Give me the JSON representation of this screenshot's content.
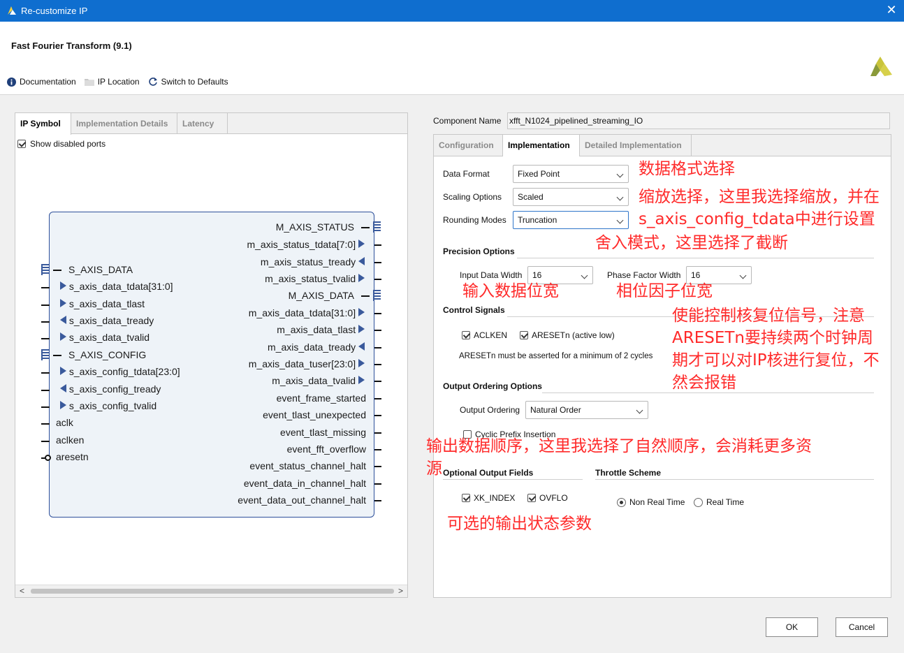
{
  "window": {
    "title": "Re-customize IP",
    "close": "✕"
  },
  "header": {
    "title": "Fast Fourier Transform (9.1)"
  },
  "toolbar": {
    "documentation": "Documentation",
    "ip_location": "IP Location",
    "switch_defaults": "Switch to Defaults"
  },
  "left_tabs": [
    "IP Symbol",
    "Implementation Details",
    "Latency"
  ],
  "show_disabled_ports": "Show disabled ports",
  "symbol": {
    "left": [
      "S_AXIS_DATA",
      "s_axis_data_tdata[31:0]",
      "s_axis_data_tlast",
      "s_axis_data_tready",
      "s_axis_data_tvalid",
      "S_AXIS_CONFIG",
      "s_axis_config_tdata[23:0]",
      "s_axis_config_tready",
      "s_axis_config_tvalid",
      "aclk",
      "aclken",
      "aresetn"
    ],
    "right": [
      "M_AXIS_STATUS",
      "m_axis_status_tdata[7:0]",
      "m_axis_status_tready",
      "m_axis_status_tvalid",
      "M_AXIS_DATA",
      "m_axis_data_tdata[31:0]",
      "m_axis_data_tlast",
      "m_axis_data_tready",
      "m_axis_data_tuser[23:0]",
      "m_axis_data_tvalid",
      "event_frame_started",
      "event_tlast_unexpected",
      "event_tlast_missing",
      "event_fft_overflow",
      "event_status_channel_halt",
      "event_data_in_channel_halt",
      "event_data_out_channel_halt"
    ]
  },
  "component": {
    "label": "Component Name",
    "value": "xfft_N1024_pipelined_streaming_IO"
  },
  "right_tabs": [
    "Configuration",
    "Implementation",
    "Detailed Implementation"
  ],
  "impl": {
    "data_format_label": "Data Format",
    "data_format": "Fixed Point",
    "scaling_label": "Scaling Options",
    "scaling": "Scaled",
    "rounding_label": "Rounding Modes",
    "rounding": "Truncation",
    "precision_section": "Precision Options",
    "input_width_label": "Input Data Width",
    "input_width": "16",
    "phase_width_label": "Phase Factor Width",
    "phase_width": "16",
    "control_section": "Control Signals",
    "aclken": "ACLKEN",
    "aresetn": "ARESETn (active low)",
    "aresetn_note": "ARESETn must be asserted for a minimum of 2 cycles",
    "ordering_section": "Output Ordering Options",
    "ordering_label": "Output Ordering",
    "ordering": "Natural Order",
    "cyclic_prefix": "Cyclic Prefix Insertion",
    "optional_section": "Optional Output Fields",
    "throttle_section": "Throttle Scheme",
    "xk_index": "XK_INDEX",
    "ovflo": "OVFLO",
    "non_real_time": "Non Real Time",
    "real_time": "Real Time"
  },
  "annotations": {
    "a1": "数据格式选择",
    "a2": "缩放选择，这里我选择缩放，并在",
    "a3": "s_axis_config_tdata中进行设置",
    "a4": "舍入模式，这里选择了截断",
    "a5": "输入数据位宽",
    "a6": "相位因子位宽",
    "a7": "使能控制核复位信号，注意",
    "a8": "ARESETn要持续两个时钟周",
    "a9": "期才可以对IP核进行复位，不",
    "a10": "然会报错",
    "a11": "输出数据顺序，这里我选择了自然顺序，会消耗更多资",
    "a12": "源",
    "a13": "可选的输出状态参数"
  },
  "buttons": {
    "ok": "OK",
    "cancel": "Cancel"
  }
}
